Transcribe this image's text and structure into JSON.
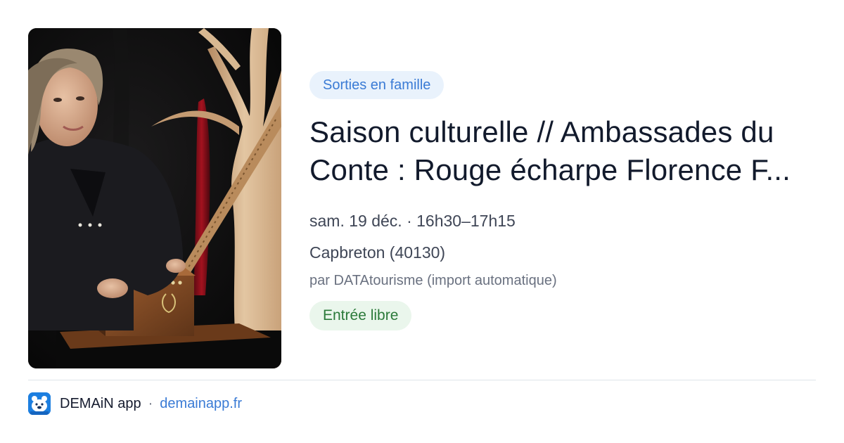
{
  "event": {
    "image_alt": "Conteuse avec une petite boîte en bois et une harpe",
    "category": "Sorties en famille",
    "title_line1": "Saison culturelle // Ambassades du",
    "title_line2": "Conte : Rouge écharpe Florence F...",
    "datetime": "sam. 19 déc. · 16h30–17h15",
    "location": "Capbreton (40130)",
    "organizer": "par DATAtourisme (import automatique)",
    "price": "Entrée libre"
  },
  "footer": {
    "app_name": "DEMAiN app",
    "separator": "·",
    "url": "demainapp.fr"
  },
  "colors": {
    "accent": "#3a7bd5",
    "category_bg": "#e9f2fc",
    "price_text": "#2b7a3a",
    "price_bg": "#eaf6ec",
    "logo_bg": "#1d7fe0"
  }
}
